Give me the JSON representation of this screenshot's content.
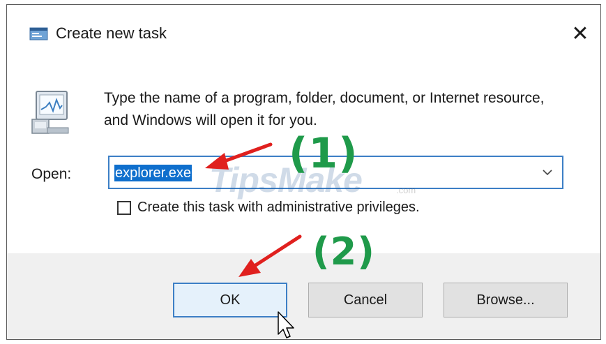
{
  "window": {
    "title": "Create new task",
    "close_symbol": "✕",
    "icon": "run-dialog-icon"
  },
  "body": {
    "description": "Type the name of a program, folder, document, or Internet resource, and Windows will open it for you.",
    "open_label": "Open:",
    "open_value": "explorer.exe",
    "program_icon": "program-monitor-icon",
    "dropdown_icon": "chevron-down-icon",
    "admin_checkbox_label": "Create this task with administrative privileges.",
    "admin_checked": false
  },
  "buttons": {
    "ok": "OK",
    "cancel": "Cancel",
    "browse": "Browse..."
  },
  "annotations": {
    "step1": "(1)",
    "step2": "(2)",
    "watermark": "TipsMake",
    "watermark_suffix": ".com",
    "arrow_color": "#e0201e",
    "step_color": "#1f9a4a"
  },
  "colors": {
    "accent": "#3c7fc6",
    "selection": "#0f6fcd",
    "footer_bg": "#f0f0f0"
  }
}
